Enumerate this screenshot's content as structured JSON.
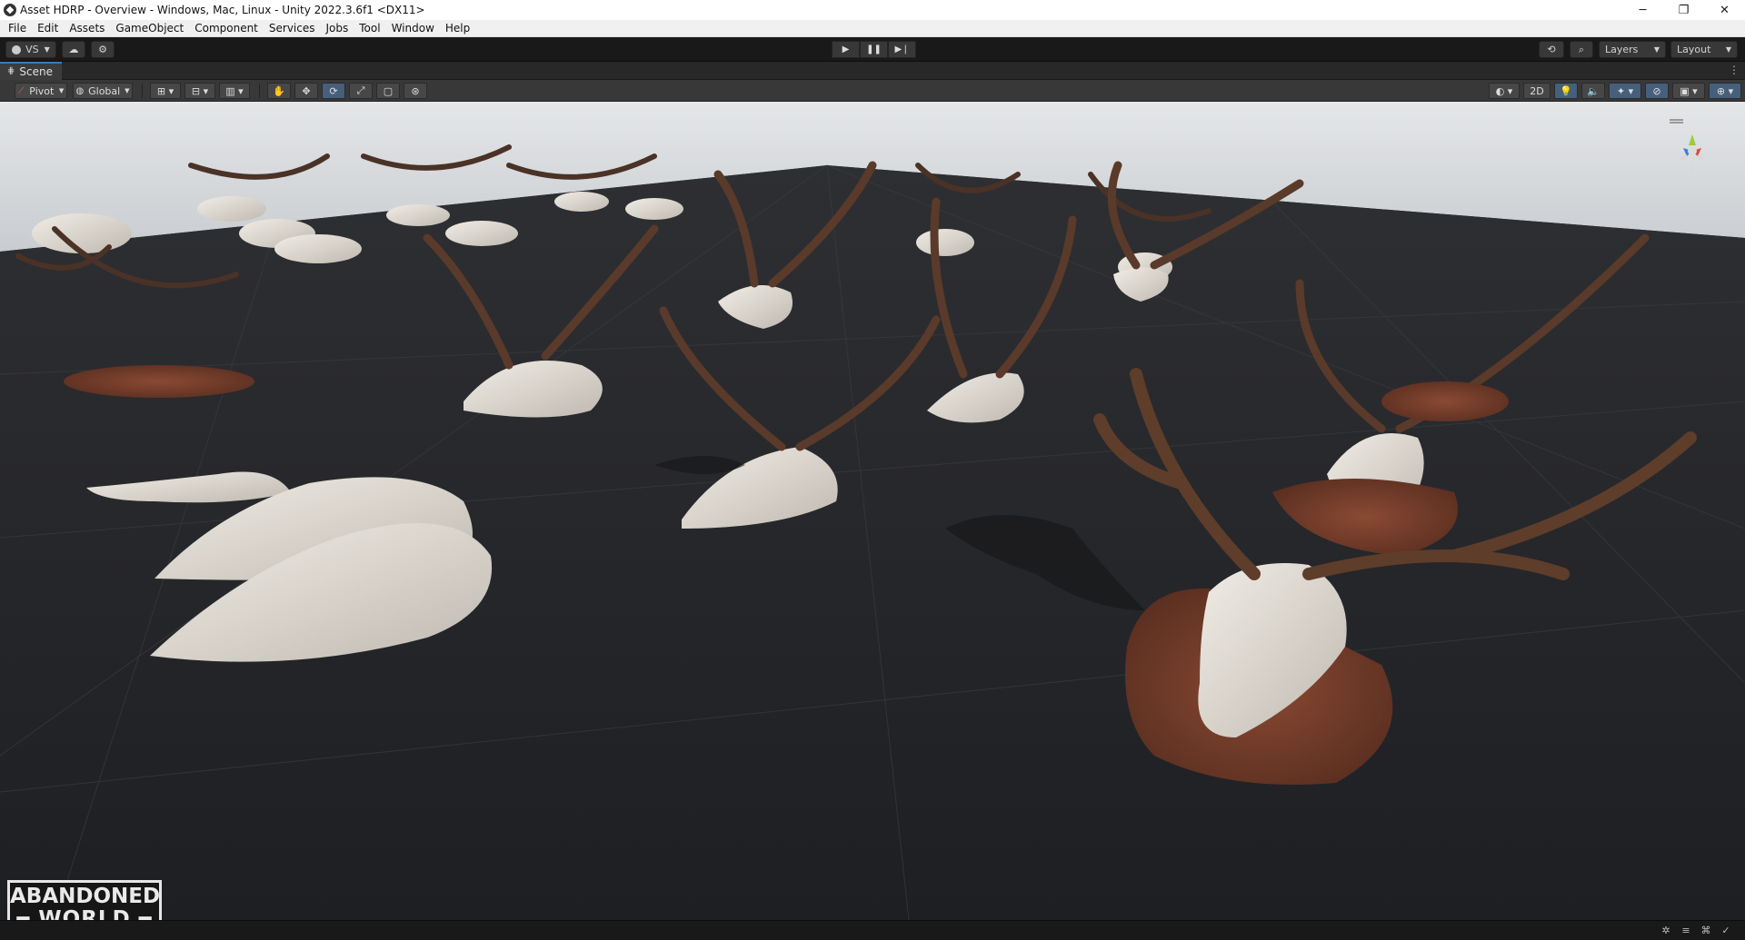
{
  "window": {
    "title": "Asset HDRP - Overview - Windows, Mac, Linux - Unity 2022.3.6f1 <DX11>",
    "controls": {
      "minimize": "─",
      "restore": "❐",
      "close": "✕"
    }
  },
  "menu": [
    "File",
    "Edit",
    "Assets",
    "GameObject",
    "Component",
    "Services",
    "Jobs",
    "Tool",
    "Window",
    "Help"
  ],
  "toolbar": {
    "account_label": "VS",
    "cloud_icon": "cloud-icon",
    "collab_icon": "collab-icon",
    "play": "▶",
    "pause": "❚❚",
    "step": "▶❘",
    "history_icon": "history-icon",
    "search_icon": "search-icon",
    "layers_label": "Layers",
    "layout_label": "Layout"
  },
  "scene_tab": {
    "label": "Scene"
  },
  "scene_toolbar": {
    "pivot_label": "Pivot",
    "global_label": "Global",
    "mode_2d": "2D"
  },
  "watermark": {
    "line1": "ABANDONED",
    "line2": "WORLD"
  }
}
